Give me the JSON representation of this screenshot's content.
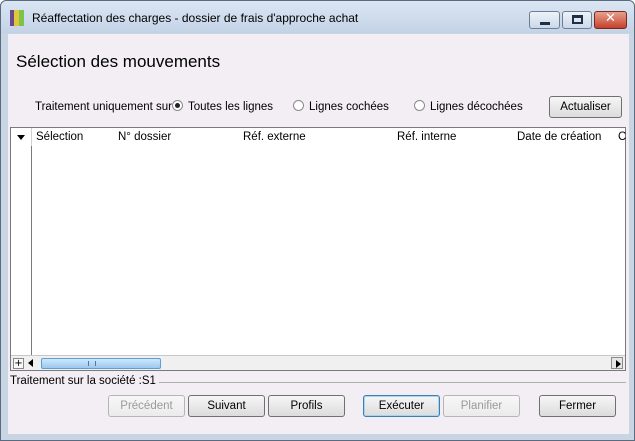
{
  "window": {
    "title": "Réaffectation des charges - dossier de frais d'approche achat",
    "close_glyph": "✕"
  },
  "page": {
    "title": "Sélection des mouvements"
  },
  "filter": {
    "label": "Traitement uniquement sur :",
    "options": [
      {
        "label": "Toutes les lignes",
        "checked": true
      },
      {
        "label": "Lignes cochées",
        "checked": false
      },
      {
        "label": "Lignes décochées",
        "checked": false
      }
    ],
    "refresh_label": "Actualiser"
  },
  "grid": {
    "columns": [
      "Sélection",
      "N° dossier",
      "Réf. externe",
      "Réf. interne",
      "Date de création",
      "C"
    ],
    "rows": [],
    "add_glyph": "+"
  },
  "footer": {
    "company_text": "Traitement sur la société :S1",
    "buttons": {
      "previous": "Précédent",
      "next": "Suivant",
      "profiles": "Profils",
      "execute": "Exécuter",
      "schedule": "Planifier",
      "close": "Fermer"
    }
  }
}
